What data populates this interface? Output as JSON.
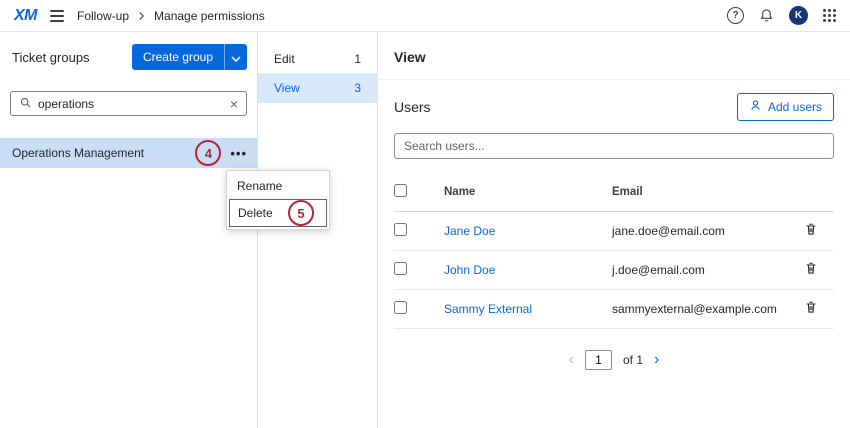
{
  "topbar": {
    "logo": "XM",
    "breadcrumb": {
      "section": "Follow-up",
      "page": "Manage permissions"
    },
    "avatar_initial": "K"
  },
  "left_panel": {
    "title": "Ticket groups",
    "create_button_label": "Create group",
    "search_value": "operations",
    "group_name": "Operations Management",
    "menu": {
      "rename": "Rename",
      "delete": "Delete"
    }
  },
  "middle_panel": {
    "items": [
      {
        "label": "Edit",
        "count": "1"
      },
      {
        "label": "View",
        "count": "3"
      }
    ]
  },
  "main": {
    "title": "View",
    "users_title": "Users",
    "add_users_label": "Add users",
    "search_placeholder": "Search users...",
    "table": {
      "columns": [
        "Name",
        "Email"
      ],
      "rows": [
        {
          "name": "Jane Doe",
          "email": "jane.doe@email.com"
        },
        {
          "name": "John Doe",
          "email": "j.doe@email.com"
        },
        {
          "name": "Sammy External",
          "email": "sammyexternal@example.com"
        }
      ]
    },
    "pagination": {
      "page": "1",
      "of_label": "of 1"
    }
  },
  "annotations": {
    "step4": "4",
    "step5": "5"
  },
  "colors": {
    "accent": "#0768dd",
    "annotation_red": "#b32638",
    "selected_group_row": "#c9def4",
    "selected_mid_item": "#d7e9fb"
  }
}
